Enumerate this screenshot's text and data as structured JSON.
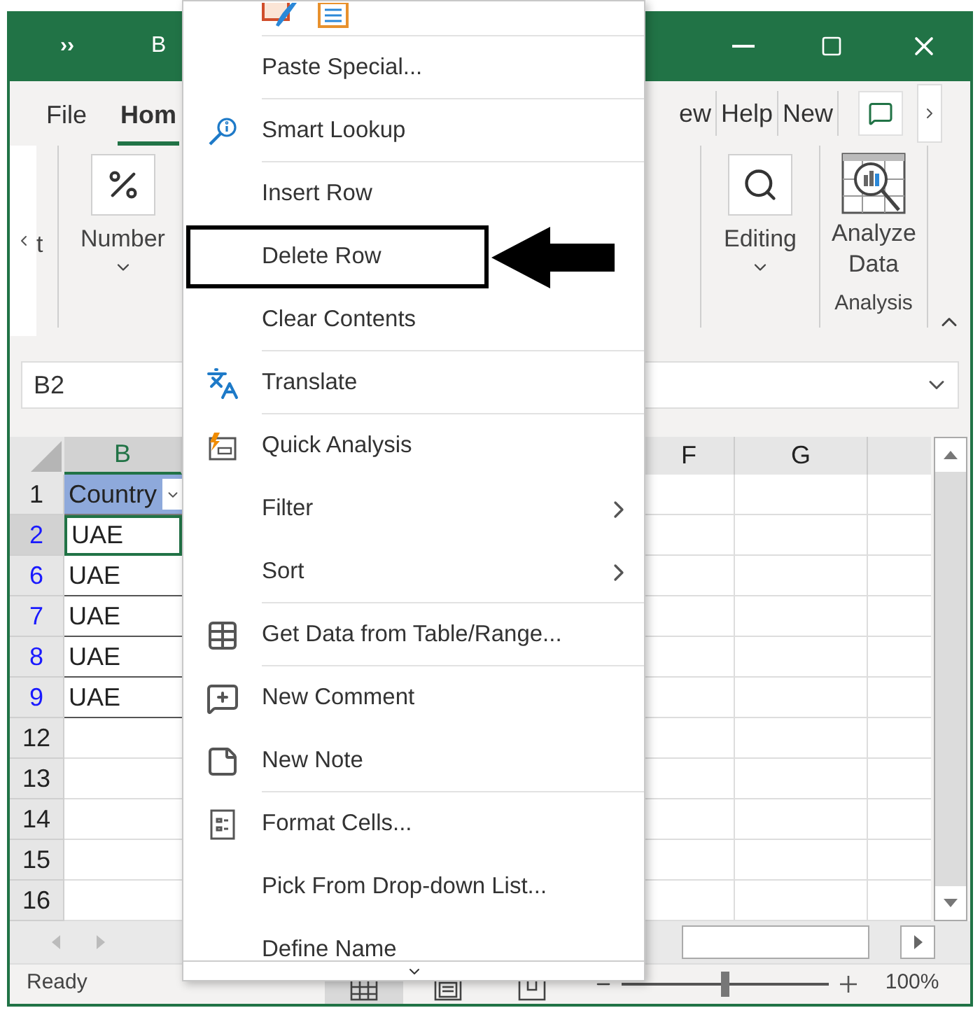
{
  "window": {
    "quick_access": "››",
    "title": "B"
  },
  "ribbon_tabs": [
    {
      "label": "File",
      "selected": false
    },
    {
      "label": "Hom",
      "selected": true
    },
    {
      "label": "ew",
      "selected": false
    },
    {
      "label": "Help",
      "selected": false
    },
    {
      "label": "New",
      "selected": false
    }
  ],
  "ribbon": {
    "cut_group_label": "t",
    "groups": [
      {
        "kind": "percent",
        "label": "Number",
        "dropdown": true
      },
      {
        "kind": "search",
        "label": "Editing",
        "dropdown": true
      },
      {
        "kind": "analyze",
        "label": "Analyze Data",
        "dropdown": false
      }
    ],
    "group_caption": "Analysis"
  },
  "name_box": "B2",
  "columns": [
    {
      "label": "B",
      "selected": true
    },
    {
      "label": "F",
      "selected": false
    },
    {
      "label": "G",
      "selected": false
    }
  ],
  "rows": [
    {
      "number": "1",
      "kind": "header",
      "cell": "Country",
      "filtered": false,
      "selected": false
    },
    {
      "number": "2",
      "kind": "data",
      "cell": "UAE",
      "filtered": true,
      "selected": true
    },
    {
      "number": "6",
      "kind": "data",
      "cell": "UAE",
      "filtered": true,
      "selected": false
    },
    {
      "number": "7",
      "kind": "data",
      "cell": "UAE",
      "filtered": true,
      "selected": false
    },
    {
      "number": "8",
      "kind": "data",
      "cell": "UAE",
      "filtered": true,
      "selected": false
    },
    {
      "number": "9",
      "kind": "data",
      "cell": "UAE",
      "filtered": true,
      "selected": false
    },
    {
      "number": "12",
      "kind": "empty",
      "filtered": false,
      "selected": false
    },
    {
      "number": "13",
      "kind": "empty",
      "filtered": false,
      "selected": false
    },
    {
      "number": "14",
      "kind": "empty",
      "filtered": false,
      "selected": false
    },
    {
      "number": "15",
      "kind": "empty",
      "filtered": false,
      "selected": false
    },
    {
      "number": "16",
      "kind": "empty",
      "filtered": false,
      "selected": false
    }
  ],
  "context_menu": {
    "items": [
      {
        "label": "Paste Special...",
        "kind": "plain",
        "submenu": false,
        "separator_after": true,
        "annotated": false
      },
      {
        "label": "Smart Lookup",
        "kind": "lookup",
        "submenu": false,
        "separator_after": true,
        "annotated": false
      },
      {
        "label": "Insert Row",
        "kind": "plain",
        "submenu": false,
        "separator_after": false,
        "annotated": false
      },
      {
        "label": "Delete Row",
        "kind": "plain",
        "submenu": false,
        "separator_after": false,
        "annotated": true
      },
      {
        "label": "Clear Contents",
        "kind": "plain",
        "submenu": false,
        "separator_after": true,
        "annotated": false
      },
      {
        "label": "Translate",
        "kind": "translate",
        "submenu": false,
        "separator_after": true,
        "annotated": false
      },
      {
        "label": "Quick Analysis",
        "kind": "quick",
        "submenu": false,
        "separator_after": false,
        "annotated": false
      },
      {
        "label": "Filter",
        "kind": "plain",
        "submenu": true,
        "separator_after": false,
        "annotated": false
      },
      {
        "label": "Sort",
        "kind": "plain",
        "submenu": true,
        "separator_after": true,
        "annotated": false
      },
      {
        "label": "Get Data from Table/Range...",
        "kind": "table",
        "submenu": false,
        "separator_after": true,
        "annotated": false
      },
      {
        "label": "New Comment",
        "kind": "comment",
        "submenu": false,
        "separator_after": false,
        "annotated": false
      },
      {
        "label": "New Note",
        "kind": "note",
        "submenu": false,
        "separator_after": true,
        "annotated": false
      },
      {
        "label": "Format Cells...",
        "kind": "format",
        "submenu": false,
        "separator_after": false,
        "annotated": false
      },
      {
        "label": "Pick From Drop-down List...",
        "kind": "plain",
        "submenu": false,
        "separator_after": false,
        "annotated": false
      },
      {
        "label": "Define Name",
        "kind": "plain",
        "submenu": false,
        "annotated": false
      }
    ]
  },
  "status_bar": {
    "text": "Ready",
    "views": [
      {
        "kind": "normal",
        "selected": true
      },
      {
        "kind": "page_layout",
        "selected": false
      },
      {
        "kind": "page_break",
        "selected": false
      }
    ],
    "zoom": {
      "level": 0.5,
      "reading": "100%"
    }
  }
}
